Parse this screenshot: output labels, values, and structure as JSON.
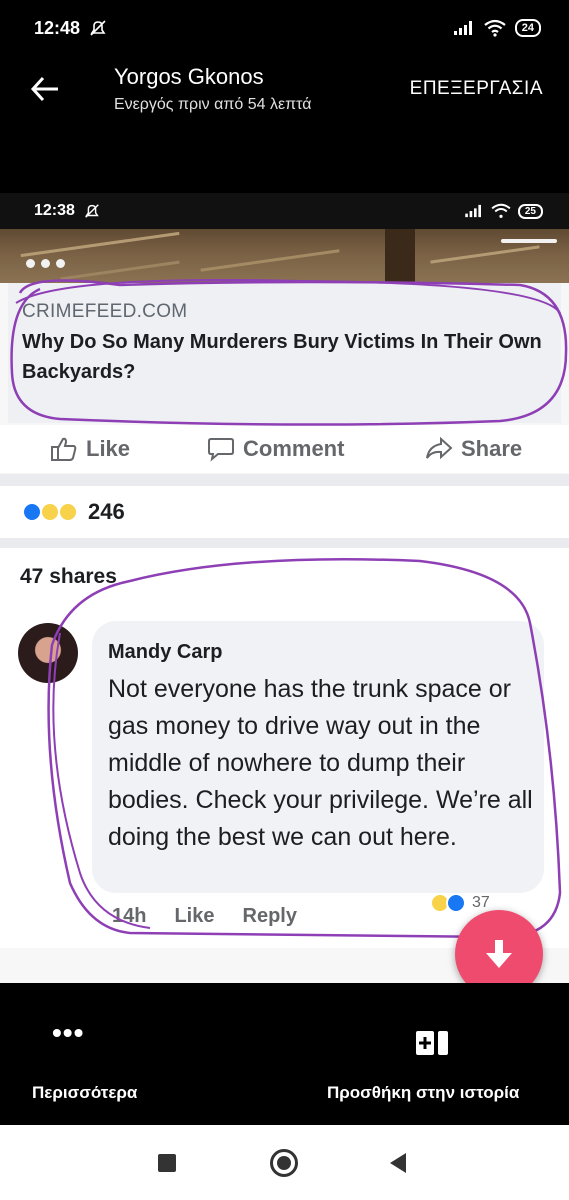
{
  "status_bar": {
    "time": "12:48",
    "battery": "24"
  },
  "header": {
    "user_name": "Yorgos Gkonos",
    "subtitle": "Ενεργός πριν από 54 λεπτά",
    "edit_label": "ΕΠΕΞΕΡΓΑΣΙΑ"
  },
  "screenshot": {
    "status_bar": {
      "time": "12:38",
      "battery": "25"
    },
    "link": {
      "source": "CRIMEFEED.COM",
      "headline": "Why Do So Many Murderers Bury Victims In Their Own Backyards?"
    },
    "actions": {
      "like": "Like",
      "comment": "Comment",
      "share": "Share"
    },
    "reaction_count": "246",
    "shares": "47 shares",
    "comment": {
      "author": "Mandy Carp",
      "text": "Not everyone has the trunk space or gas money to drive way out in the middle of nowhere to dump their bodies. Check your privilege. We’re all doing the best we can out here.",
      "time": "14h",
      "like": "Like",
      "reply": "Reply",
      "reaction_count": "37"
    }
  },
  "bottom_bar": {
    "more_label": "Περισσότερα",
    "add_story_label": "Προσθήκη στην ιστορία"
  },
  "colors": {
    "fab": "#ef4b6f",
    "annotation": "#8e3fb5",
    "facebook_blue": "#1877f2"
  }
}
